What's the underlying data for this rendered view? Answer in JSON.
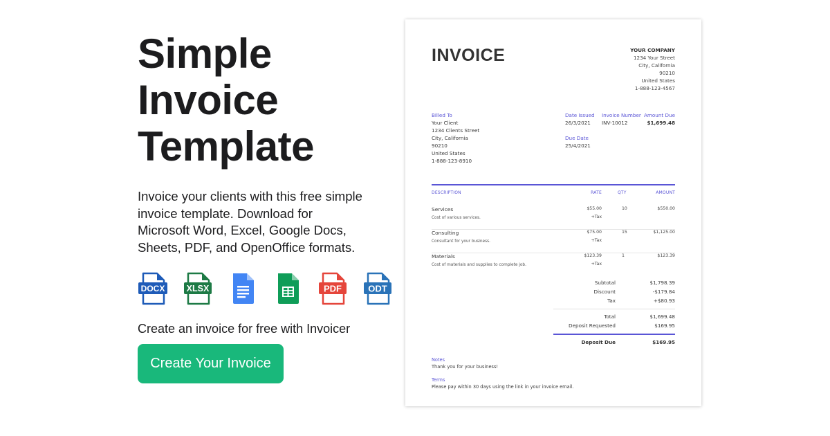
{
  "hero": {
    "title_lines": [
      "Simple",
      "Invoice",
      "Template"
    ],
    "description": "Invoice your clients with this free simple invoice template. Download for Microsoft Word, Excel, Google Docs, Sheets, PDF, and OpenOffice formats.",
    "formats": [
      {
        "label": "DOCX",
        "icon": "docx-file-icon",
        "color": "#1e5bb8"
      },
      {
        "label": "XLSX",
        "icon": "xlsx-file-icon",
        "color": "#1d7a45"
      },
      {
        "label": "",
        "icon": "google-docs-icon",
        "color": "#3f7ee8"
      },
      {
        "label": "",
        "icon": "google-sheets-icon",
        "color": "#21a464"
      },
      {
        "label": "PDF",
        "icon": "pdf-file-icon",
        "color": "#e5453b"
      },
      {
        "label": "ODT",
        "icon": "odt-file-icon",
        "color": "#2a73b8"
      }
    ],
    "cta_text": "Create an invoice for free with Invoicer",
    "cta_button": "Create Your Invoice",
    "accent": "#19b87b"
  },
  "invoice": {
    "title": "INVOICE",
    "accent": "#5a55d6",
    "company": {
      "name": "YOUR COMPANY",
      "street": "1234 Your Street",
      "city": "City, California",
      "zip": "90210",
      "country": "United States",
      "phone": "1-888-123-4567"
    },
    "billed_to": {
      "label": "Billed To",
      "name": "Your Client",
      "street": "1234 Clients Street",
      "city": "City, California",
      "zip": "90210",
      "country": "United States",
      "phone": "1-888-123-8910"
    },
    "date_issued": {
      "label": "Date Issued",
      "value": "26/3/2021"
    },
    "due_date": {
      "label": "Due Date",
      "value": "25/4/2021"
    },
    "invoice_number": {
      "label": "Invoice Number",
      "value": "INV-10012"
    },
    "amount_due": {
      "label": "Amount Due",
      "value": "$1,699.48"
    },
    "columns": {
      "description": "DESCRIPTION",
      "rate": "RATE",
      "qty": "QTY",
      "amount": "AMOUNT"
    },
    "items": [
      {
        "name": "Services",
        "sub": "Cost of various services.",
        "rate": "$55.00",
        "tax": "+Tax",
        "qty": "10",
        "amount": "$550.00"
      },
      {
        "name": "Consulting",
        "sub": "Consultant for your business.",
        "rate": "$75.00",
        "tax": "+Tax",
        "qty": "15",
        "amount": "$1,125.00"
      },
      {
        "name": "Materials",
        "sub": "Cost of materials and supplies to complete job.",
        "rate": "$123.39",
        "tax": "+Tax",
        "qty": "1",
        "amount": "$123.39"
      }
    ],
    "totals": {
      "subtotal": {
        "label": "Subtotal",
        "value": "$1,798.39"
      },
      "discount": {
        "label": "Discount",
        "value": "-$179.84"
      },
      "tax": {
        "label": "Tax",
        "value": "+$80.93"
      },
      "total": {
        "label": "Total",
        "value": "$1,699.48"
      },
      "deposit_requested": {
        "label": "Deposit Requested",
        "value": "$169.95"
      },
      "deposit_due": {
        "label": "Deposit Due",
        "value": "$169.95"
      }
    },
    "notes": {
      "label": "Notes",
      "text": "Thank you for your business!"
    },
    "terms": {
      "label": "Terms",
      "text": "Please pay within 30 days using the link in your invoice email."
    }
  }
}
